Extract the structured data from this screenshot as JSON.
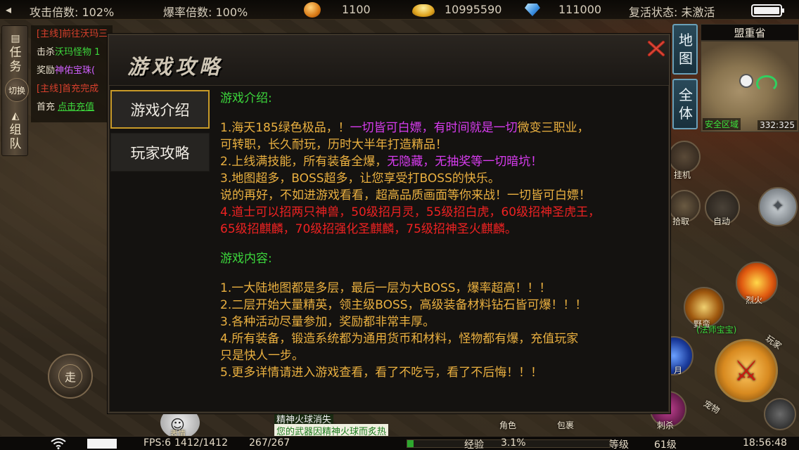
{
  "top_hud": {
    "attack_multiplier": "攻击倍数: 102%",
    "drop_multiplier": "爆率倍数: 100%",
    "gold": "1100",
    "ingots": "10995590",
    "diamonds": "111000",
    "revive_status": "复活状态: 未激活"
  },
  "side_tabs": {
    "task": "任务",
    "switch": "切换",
    "team": "组队"
  },
  "quest": {
    "line1_tag": "[主线]",
    "line1_text": "前往沃玛三",
    "line2_label": "击杀",
    "line2_target": "沃玛怪物 1",
    "line3_label": "奖励",
    "line3_reward": "神佑宝珠(",
    "line4_tag": "[主线]",
    "line4_text": "首充完成",
    "line5_label": "首充",
    "line5_link": "点击充值"
  },
  "minimap": {
    "btn_map": "地图",
    "btn_all": "全体",
    "region": "盟重省",
    "zone": "安全区域",
    "coords": "332:325"
  },
  "skills": {
    "pickup": "拾取",
    "auto": "自动",
    "hang": "挂机",
    "fire": "烈火",
    "wild": "野蛮",
    "half_moon": "月",
    "assassinate": "刺杀",
    "player": "玩家",
    "pet": "宠物",
    "pet_status": "(法师宝宝)",
    "role": "角色",
    "bag": "包裹"
  },
  "chat": {
    "line1": "精神火球消失",
    "line2": "您的武器因精神火球而炙热"
  },
  "walk_label": "走",
  "bottom_hud": {
    "fps": "FPS:6",
    "hp": "1412/1412",
    "mp": "267/267",
    "exp_label": "经验",
    "exp_value": "3.1%",
    "exp_fraction": 0.031,
    "level_label": "等级",
    "level": "61级",
    "time": "18:56:48",
    "expression": "表情"
  },
  "dialog": {
    "title": "游戏攻略",
    "tabs": [
      {
        "label": "游戏介绍",
        "active": true
      },
      {
        "label": "玩家攻略",
        "active": false
      }
    ],
    "intro_heading": "游戏介绍:",
    "intro_1a": "1.海天185绿色极品，！",
    "intro_1b": "一切皆可白嫖，有时间就是一切",
    "intro_1c": "微变三职业，",
    "intro_1d": "可转职，长久耐玩，历时大半年打造精品！",
    "intro_2a": "2.上线满技能，所有装备全爆，",
    "intro_2b": "无隐藏，无抽奖等一切暗坑！",
    "intro_3": "3.地图超多，BOSS超多，让您享受打BOSS的快乐。",
    "intro_3b": "说的再好，不如进游戏看看，超高品质画面等你来战！一切皆可白嫖！",
    "intro_4a": "4.道士可以招两只神兽，50级招月灵，55级招白虎，60级招神圣虎王，",
    "intro_4b": "65级招麒麟，70级招强化圣麒麟，75级招神圣火麒麟。",
    "content_heading": "游戏内容:",
    "content_1": "1.一大陆地图都是多层，最后一层为大BOSS，爆率超高！！！",
    "content_2": "2.二层开始大量精英，领主级BOSS，高级装备材料钻石皆可爆！！！",
    "content_3": "3.各种活动尽量参加，奖励都非常丰厚。",
    "content_4a": "4.所有装备，锻造系统都为通用货币和材料，怪物都有爆，充值玩家",
    "content_4b": "只是快人一步。",
    "content_5": "5.更多详情请进入游戏查看，看了不吃亏，看了不后悔！！！"
  },
  "colors": {
    "heading_green": "#3cd83c",
    "body_orange": "#eab040",
    "highlight_purple": "#d83cf0",
    "highlight_red": "#ee2222",
    "tab_active_border": "#c89a28"
  }
}
